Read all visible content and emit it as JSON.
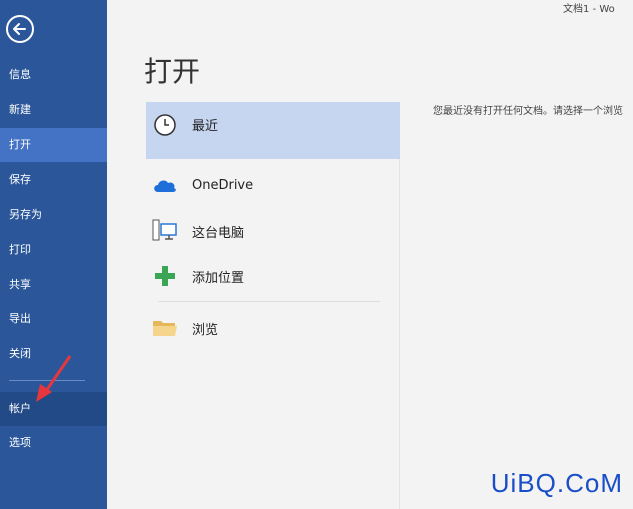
{
  "window": {
    "title": "文档1 - Wo"
  },
  "sidebar": {
    "items": [
      {
        "label": "信息"
      },
      {
        "label": "新建"
      },
      {
        "label": "打开"
      },
      {
        "label": "保存"
      },
      {
        "label": "另存为"
      },
      {
        "label": "打印"
      },
      {
        "label": "共享"
      },
      {
        "label": "导出"
      },
      {
        "label": "关闭"
      },
      {
        "label": "帐户"
      },
      {
        "label": "选项"
      }
    ]
  },
  "main": {
    "title": "打开",
    "locations": [
      {
        "label": "最近",
        "icon": "clock-icon"
      },
      {
        "label": "OneDrive",
        "icon": "cloud-icon"
      },
      {
        "label": "这台电脑",
        "icon": "computer-icon"
      },
      {
        "label": "添加位置",
        "icon": "plus-icon"
      },
      {
        "label": "浏览",
        "icon": "folder-icon"
      }
    ],
    "empty_message": "您最近没有打开任何文档。请选择一个浏览"
  },
  "watermark": "UiBQ.CoM",
  "colors": {
    "sidebar": "#2b579a",
    "sidebar_active": "#4472c4",
    "selected_location": "#c7d6f0",
    "arrow": "#e8363d"
  }
}
